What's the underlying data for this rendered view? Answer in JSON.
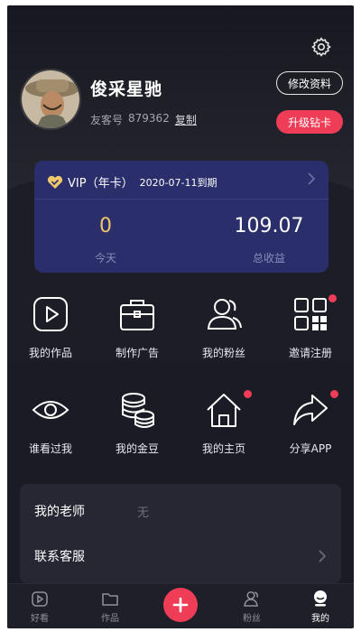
{
  "profile": {
    "username": "俊采星驰",
    "uid_label": "友客号",
    "uid_value": "879362",
    "copy_label": "复制",
    "edit_label": "修改资料",
    "upgrade_label": "升级钻卡"
  },
  "vip": {
    "label": "VIP（年卡）",
    "expiry": "2020-07-11到期",
    "today_value": "0",
    "today_label": "今天",
    "total_value": "109.07",
    "total_label": "总收益"
  },
  "menu": [
    {
      "label": "我的作品",
      "icon": "play-square-icon",
      "badge": false
    },
    {
      "label": "制作广告",
      "icon": "briefcase-icon",
      "badge": false
    },
    {
      "label": "我的粉丝",
      "icon": "users-icon",
      "badge": false
    },
    {
      "label": "邀请注册",
      "icon": "qrcode-icon",
      "badge": true
    },
    {
      "label": "谁看过我",
      "icon": "eye-icon",
      "badge": false
    },
    {
      "label": "我的金豆",
      "icon": "coins-icon",
      "badge": false
    },
    {
      "label": "我的主页",
      "icon": "home-icon",
      "badge": true
    },
    {
      "label": "分享APP",
      "icon": "share-icon",
      "badge": true
    }
  ],
  "list": {
    "teacher_label": "我的老师",
    "teacher_value": "无",
    "service_label": "联系客服"
  },
  "tabs": [
    {
      "label": "好看",
      "icon": "play-tab-icon"
    },
    {
      "label": "作品",
      "icon": "folder-icon"
    },
    {
      "label": "",
      "icon": "plus-icon"
    },
    {
      "label": "粉丝",
      "icon": "fans-icon"
    },
    {
      "label": "我的",
      "icon": "me-icon",
      "active": true
    }
  ],
  "colors": {
    "background": "#1a1b25",
    "accent": "#ef3d57",
    "vip_card": "#2a2e6b",
    "gold": "#f1c76b"
  }
}
